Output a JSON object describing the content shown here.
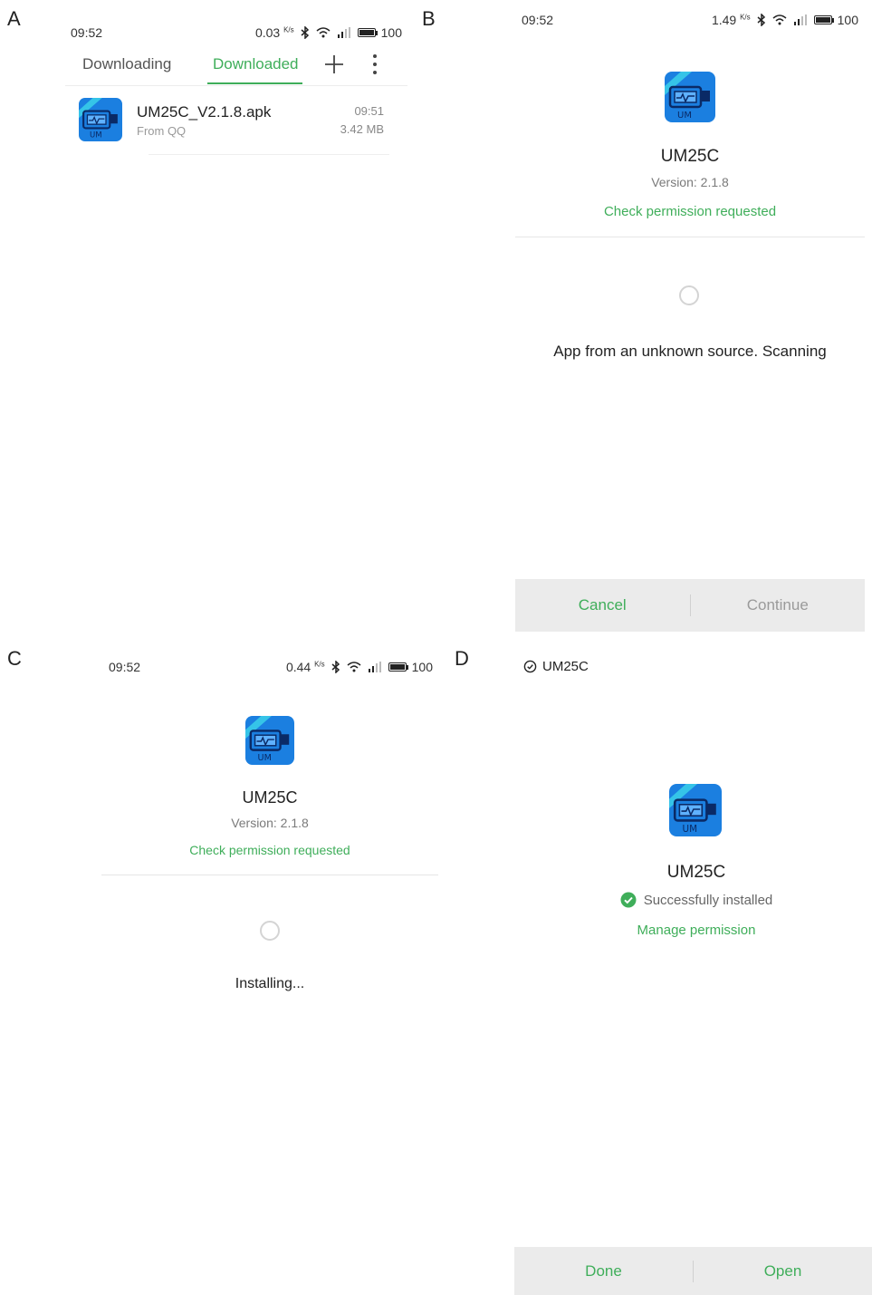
{
  "panels": {
    "a": {
      "letter": "A",
      "status": {
        "time": "09:52",
        "speed": "0.03",
        "speed_unit": "K/s",
        "battery": "100"
      },
      "tabs": [
        {
          "label": "Downloading"
        },
        {
          "label": "Downloaded"
        }
      ],
      "file": {
        "name": "UM25C_V2.1.8.apk",
        "source": "From QQ",
        "time": "09:51",
        "size": "3.42 MB"
      }
    },
    "b": {
      "letter": "B",
      "status": {
        "time": "09:52",
        "speed": "1.49",
        "speed_unit": "K/s",
        "battery": "100"
      },
      "app_name": "UM25C",
      "version": "Version: 2.1.8",
      "permission_link": "Check permission requested",
      "message": "App from an unknown source. Scanning",
      "cancel_label": "Cancel",
      "continue_label": "Continue"
    },
    "c": {
      "letter": "C",
      "status": {
        "time": "09:52",
        "speed": "0.44",
        "speed_unit": "K/s",
        "battery": "100"
      },
      "app_name": "UM25C",
      "version": "Version: 2.1.8",
      "permission_link": "Check permission requested",
      "message": "Installing..."
    },
    "d": {
      "letter": "D",
      "header_app": "UM25C",
      "app_name": "UM25C",
      "status_text": "Successfully installed",
      "manage_link": "Manage permission",
      "done_label": "Done",
      "open_label": "Open"
    }
  },
  "icon_text": {
    "brand": "UM"
  },
  "colors": {
    "accent_green": "#3fae5a",
    "icon_blue": "#1b7fe0",
    "bar_grey": "#ebebeb"
  }
}
